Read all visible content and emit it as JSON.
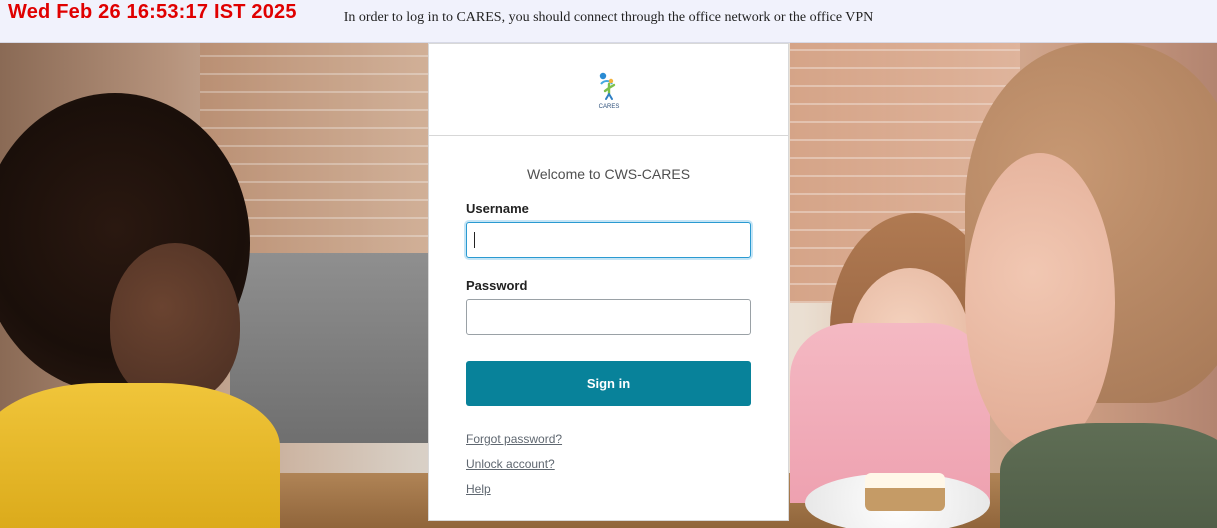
{
  "banner": {
    "clock": "Wed Feb 26 16:53:17 IST 2025",
    "message": "In order to log in to CARES, you should connect through the office network or the office VPN"
  },
  "logo": {
    "icon": "cares-logo",
    "text": "CARES"
  },
  "login": {
    "welcome": "Welcome to CWS-CARES",
    "username_label": "Username",
    "username_value": "",
    "password_label": "Password",
    "password_value": "",
    "signin_label": "Sign in",
    "links": [
      {
        "label": "Forgot password?"
      },
      {
        "label": "Unlock account?"
      },
      {
        "label": "Help"
      }
    ]
  },
  "colors": {
    "primary_button": "#08829a",
    "banner_bg": "#f1f2fc",
    "clock_red": "#e00000"
  }
}
